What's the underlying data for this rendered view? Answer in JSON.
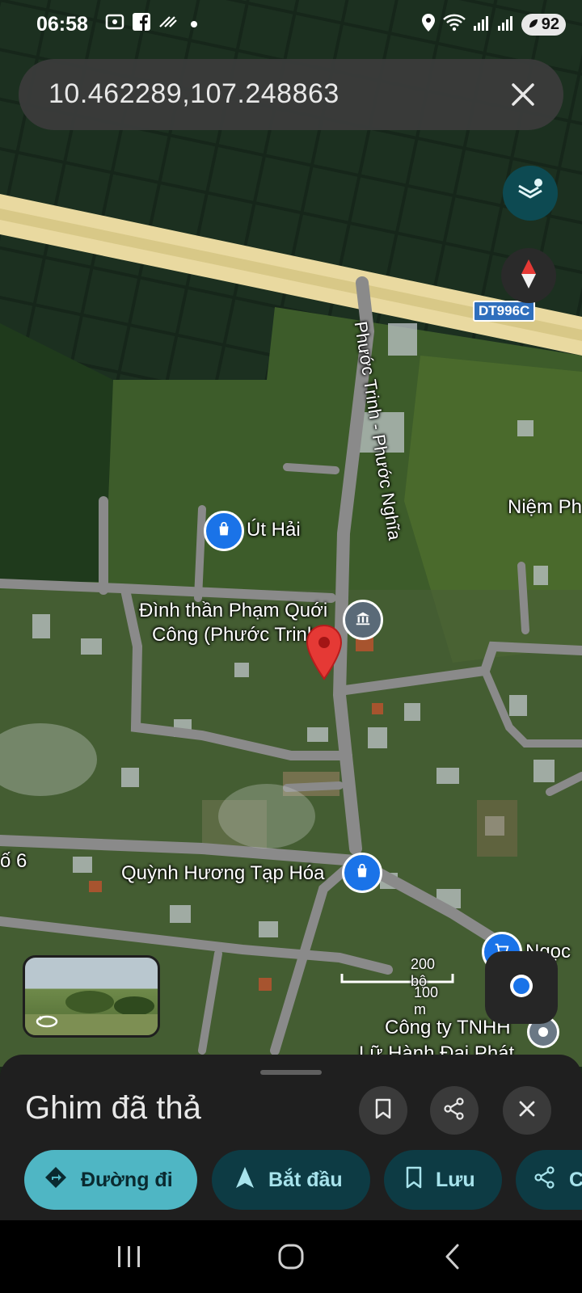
{
  "status": {
    "time": "06:58",
    "battery": "92"
  },
  "search": {
    "query": "10.462289,107.248863"
  },
  "map": {
    "road_badge": "DT996C",
    "road_name": "Phước Trinh - Phước Nghĩa",
    "labels": {
      "ut_hai": "Út Hải",
      "dinh_line1": "Đình thần Phạm Quới",
      "dinh_line2": "Công (Phước Trinh",
      "quynh_huong": "Quỳnh Hương Tạp Hóa",
      "niem_ph": "Niệm Ph",
      "ngoc": "Ngọc",
      "cong_ty_line1": "Công ty TNHH",
      "cong_ty_line2": "Lữ Hành Đại Phát",
      "edge_label": "ố 6"
    },
    "scale": {
      "top": "200 bộ",
      "bottom": "100 m"
    }
  },
  "sheet": {
    "title": "Ghim đã thả",
    "actions": {
      "directions": "Đường đi",
      "start": "Bắt đầu",
      "save": "Lưu",
      "share": "C"
    }
  },
  "colors": {
    "accent": "#4fb6c4",
    "chip_dark": "#0d3b44",
    "pin": "#e53935",
    "poi_blue": "#1a73e8"
  }
}
